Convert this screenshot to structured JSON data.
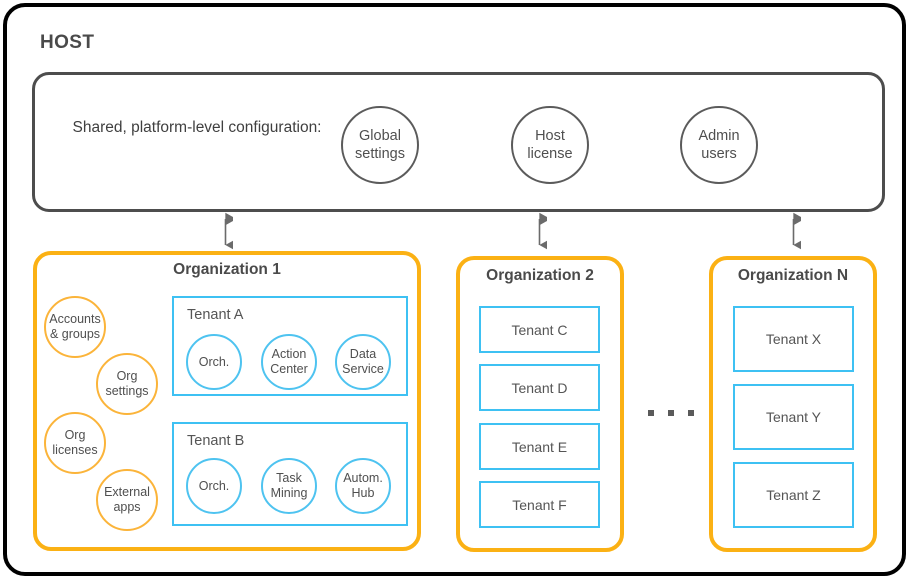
{
  "host": {
    "title": "HOST",
    "shared_config_label": "Shared, platform-level configuration:",
    "capabilities": [
      {
        "label": "Global settings",
        "icon": "gear-circle-icon"
      },
      {
        "label": "Host license",
        "icon": "license-circle-icon"
      },
      {
        "label": "Admin users",
        "icon": "users-circle-icon"
      }
    ]
  },
  "organizations": [
    {
      "title": "Organization 1",
      "org_features": [
        {
          "label": "Accounts & groups"
        },
        {
          "label": "Org settings"
        },
        {
          "label": "Org licenses"
        },
        {
          "label": "External apps"
        }
      ],
      "tenants": [
        {
          "name": "Tenant A",
          "services": [
            {
              "label": "Orch."
            },
            {
              "label": "Action Center"
            },
            {
              "label": "Data Service"
            }
          ]
        },
        {
          "name": "Tenant B",
          "services": [
            {
              "label": "Orch."
            },
            {
              "label": "Task Mining"
            },
            {
              "label": "Autom. Hub"
            }
          ]
        }
      ]
    },
    {
      "title": "Organization 2",
      "tenants": [
        {
          "name": "Tenant C"
        },
        {
          "name": "Tenant D"
        },
        {
          "name": "Tenant E"
        },
        {
          "name": "Tenant F"
        }
      ]
    },
    {
      "title": "Organization N",
      "tenants": [
        {
          "name": "Tenant X"
        },
        {
          "name": "Tenant Y"
        },
        {
          "name": "Tenant Z"
        }
      ]
    }
  ],
  "ellipsis": "· · ·",
  "colors": {
    "outer_border": "#000000",
    "host_panel_border": "#4d4d4d",
    "org_border": "#fbb114",
    "tenant_border": "#3ec1f3",
    "service_circle_border": "#4ec3f0",
    "feature_circle_border": "#fbb43a",
    "text": "#4f4f4f",
    "connector": "#6b6b6b"
  }
}
